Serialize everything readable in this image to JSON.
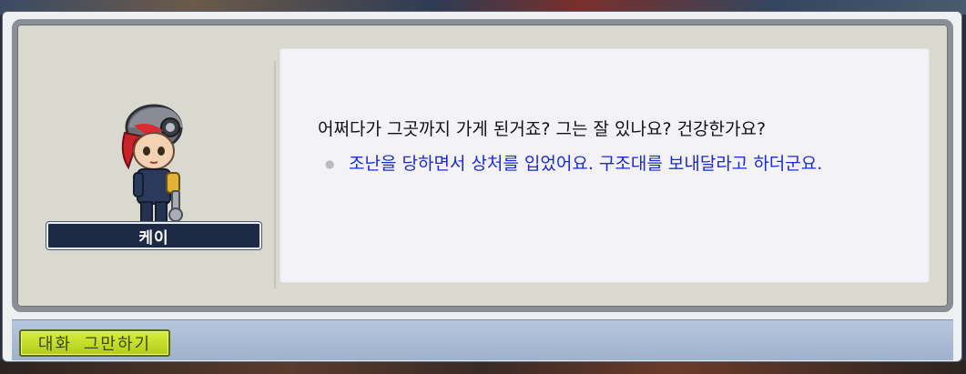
{
  "npc": {
    "name": "케이",
    "line": "어쩌다가 그곳까지 가게 된거죠? 그는 잘 있나요? 건강한가요?"
  },
  "options": [
    {
      "text": "조난을 당하면서 상처를 입었어요. 구조대를 보내달라고 하더군요."
    }
  ],
  "buttons": {
    "end_chat": "대화 그만하기"
  },
  "colors": {
    "option_text": "#1a2bd6",
    "nameplate_bg": "#1d2a45",
    "end_button": "#c6e02a"
  },
  "icons": {
    "option_bullet": "option-bullet-icon"
  }
}
